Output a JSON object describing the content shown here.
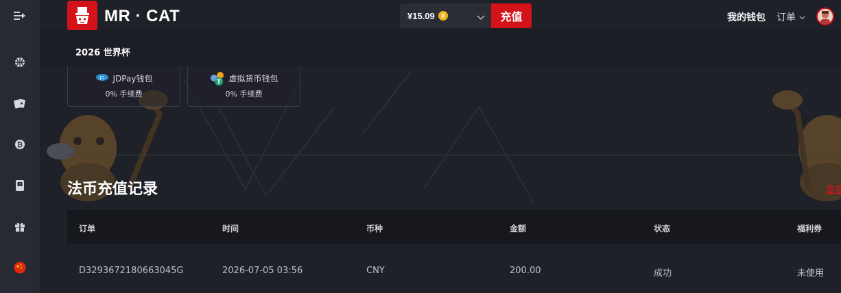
{
  "header": {
    "brand": "MR · CAT",
    "balance": "¥15.09",
    "coin_symbol": "¥",
    "deposit_label": "充值",
    "wallet_label": "我的钱包",
    "orders_label": "订单"
  },
  "subheader": {
    "title": "2026 世界杯"
  },
  "payment_methods": [
    {
      "name": "JDPay钱包",
      "fee": "0% 手续费",
      "icon": "jdpay-icon"
    },
    {
      "name": "虚拟货币钱包",
      "fee": "0% 手续费",
      "icon": "crypto-icon"
    }
  ],
  "records": {
    "title": "法币充值记录",
    "more_link": "查看",
    "columns": [
      "订单",
      "时间",
      "币种",
      "金额",
      "状态",
      "福利券"
    ],
    "rows": [
      [
        "D3293672180663045G",
        "2026-07-05 03:56",
        "CNY",
        "200.00",
        "成功",
        "未使用"
      ]
    ]
  },
  "sidebar": {
    "items": [
      {
        "icon": "collapse-menu-icon"
      },
      {
        "icon": "basketball-icon"
      },
      {
        "icon": "cards-icon"
      },
      {
        "icon": "bitcoin-icon"
      },
      {
        "icon": "slot-machine-icon"
      },
      {
        "icon": "gift-icon"
      },
      {
        "icon": "china-flag-icon"
      }
    ]
  },
  "colors": {
    "accent": "#d3121a",
    "background": "#1f2129",
    "sidebar": "#282a33"
  }
}
